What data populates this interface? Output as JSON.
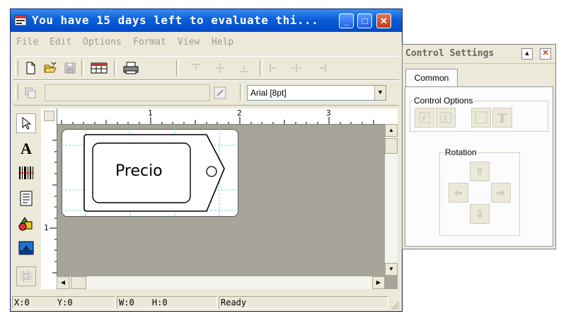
{
  "window": {
    "title": "You have 15 days left to evaluate thi...",
    "minimize": "_",
    "maximize": "□",
    "close": "✕"
  },
  "menu": [
    "File",
    "Edit",
    "Options",
    "Format",
    "View",
    "Help"
  ],
  "toolbar1": {
    "icons": [
      "new-document-icon",
      "open-folder-icon",
      "save-icon",
      "database-icon",
      "print-icon",
      "align-top-icon",
      "align-middle-icon",
      "align-bottom-icon",
      "align-left-icon",
      "align-center-icon",
      "align-right-icon"
    ]
  },
  "toolbar2": {
    "font_combo_value": "Arial [8pt]"
  },
  "ruler": {
    "h_labels": [
      "1",
      "2",
      "3"
    ],
    "v_labels": [
      "1"
    ]
  },
  "label": {
    "text": "Precio"
  },
  "status": {
    "x": "X:0",
    "y": "Y:0",
    "w": "W:0",
    "h": "H:0",
    "state": "Ready"
  },
  "control_panel": {
    "title": "Control Settings",
    "tab": "Common",
    "options_group": "Control Options",
    "rotation_group": "Rotation",
    "arrows": {
      "up": "⇧",
      "left": "⇦",
      "right": "⇨",
      "down": "⇩"
    }
  },
  "colors": {
    "titlebar": "#0a5ed8",
    "window_bg": "#ece9d8",
    "canvas_bg": "#a7a59a",
    "close_button": "#c23a17"
  }
}
